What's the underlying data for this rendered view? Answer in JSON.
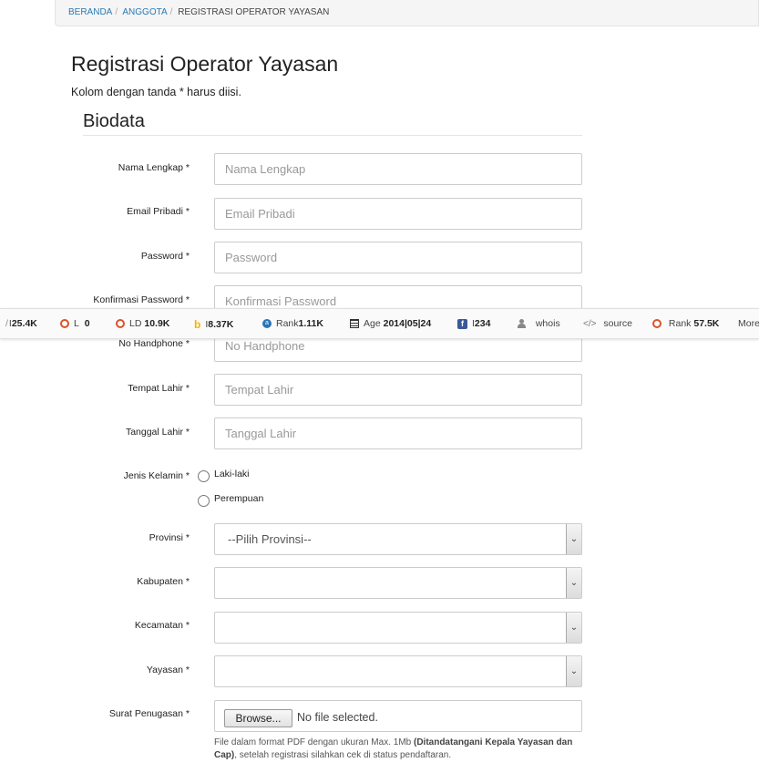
{
  "breadcrumb": {
    "items": [
      "BERANDA",
      "ANGGOTA"
    ],
    "separator": "/",
    "active": "REGISTRASI OPERATOR YAYASAN"
  },
  "page": {
    "title": "Registrasi Operator Yayasan",
    "note": "Kolom dengan tanda * harus diisi.",
    "section_title": "Biodata"
  },
  "form": {
    "nama": {
      "label": "Nama Lengkap *",
      "placeholder": "Nama Lengkap"
    },
    "email": {
      "label": "Email Pribadi *",
      "placeholder": "Email Pribadi"
    },
    "password": {
      "label": "Password *",
      "placeholder": "Password"
    },
    "konfirmasi": {
      "label": "Konfirmasi Password *",
      "placeholder": "Konfirmasi Password"
    },
    "handphone": {
      "label": "No Handphone *",
      "placeholder": "No Handphone"
    },
    "tempat_lahir": {
      "label": "Tempat Lahir *",
      "placeholder": "Tempat Lahir"
    },
    "tanggal_lahir": {
      "label": "Tanggal Lahir *",
      "placeholder": "Tanggal Lahir"
    },
    "jenis_kelamin": {
      "label": "Jenis Kelamin *",
      "options": [
        "Laki-laki",
        "Perempuan"
      ]
    },
    "provinsi": {
      "label": "Provinsi *",
      "value": "--Pilih Provinsi--"
    },
    "kabupaten": {
      "label": "Kabupaten *",
      "value": ""
    },
    "kecamatan": {
      "label": "Kecamatan *",
      "value": ""
    },
    "yayasan": {
      "label": "Yayasan *",
      "value": ""
    },
    "surat": {
      "label": "Surat Penugasan *",
      "button": "Browse...",
      "status": "No file selected.",
      "help_pre": "File dalam format PDF dengan ukuran Max. 1Mb ",
      "help_bold": "(Ditandatangani Kepala Yayasan dan Cap)",
      "help_post": ", setelah registrasi silahkan cek di status pendaftaran."
    }
  },
  "seo_toolbar": {
    "items": [
      {
        "icon": "bar-icon",
        "label": "I",
        "value": "25.4K"
      },
      {
        "icon": "ring-icon",
        "label": "L",
        "value": "0"
      },
      {
        "icon": "ring-icon",
        "label": "LD",
        "value": "10.9K"
      },
      {
        "icon": "bing-icon",
        "label": "I",
        "value": "8.37K"
      },
      {
        "icon": "alexa-icon",
        "label": "Rank",
        "value": "1.11K"
      },
      {
        "icon": "calendar-icon",
        "label": "Age",
        "value": "2014|05|24"
      },
      {
        "icon": "facebook-icon",
        "label": "I",
        "value": "234"
      },
      {
        "icon": "user-icon",
        "label": "whois",
        "value": ""
      },
      {
        "icon": "code-icon",
        "label": "source",
        "value": ""
      },
      {
        "icon": "ring-icon",
        "label": "Rank",
        "value": "57.5K"
      },
      {
        "icon": "",
        "label": "More",
        "value": ""
      }
    ],
    "accent_color": "#d9542b"
  }
}
